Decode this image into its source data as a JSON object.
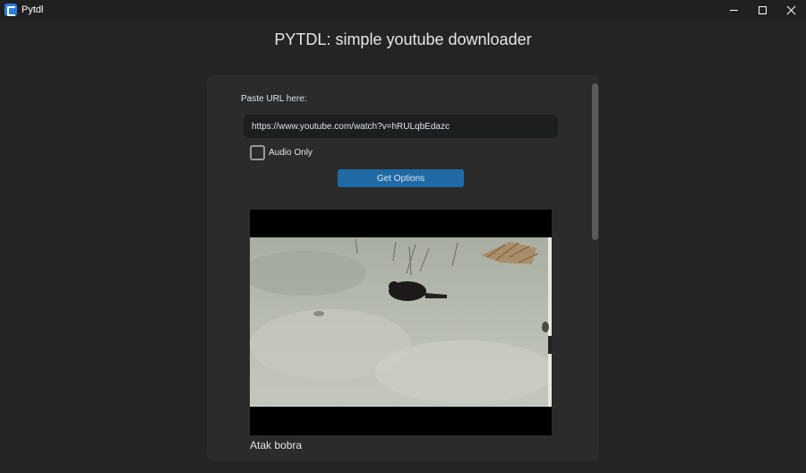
{
  "window": {
    "title": "Pytdl",
    "minimize_icon": "minimize-icon",
    "maximize_icon": "maximize-icon",
    "close_icon": "close-icon"
  },
  "header": {
    "title": "PYTDL: simple youtube downloader"
  },
  "form": {
    "url_label": "Paste URL here:",
    "url_value": "https://www.youtube.com/watch?v=hRULqbEdazc",
    "audio_only_label": "Audio Only",
    "audio_only_checked": false,
    "get_options_label": "Get Options"
  },
  "video": {
    "title": "Atak bobra"
  },
  "colors": {
    "background": "#242424",
    "frame": "#2b2b2b",
    "accent": "#1f6aa5",
    "input_bg": "#1d1e1e"
  }
}
